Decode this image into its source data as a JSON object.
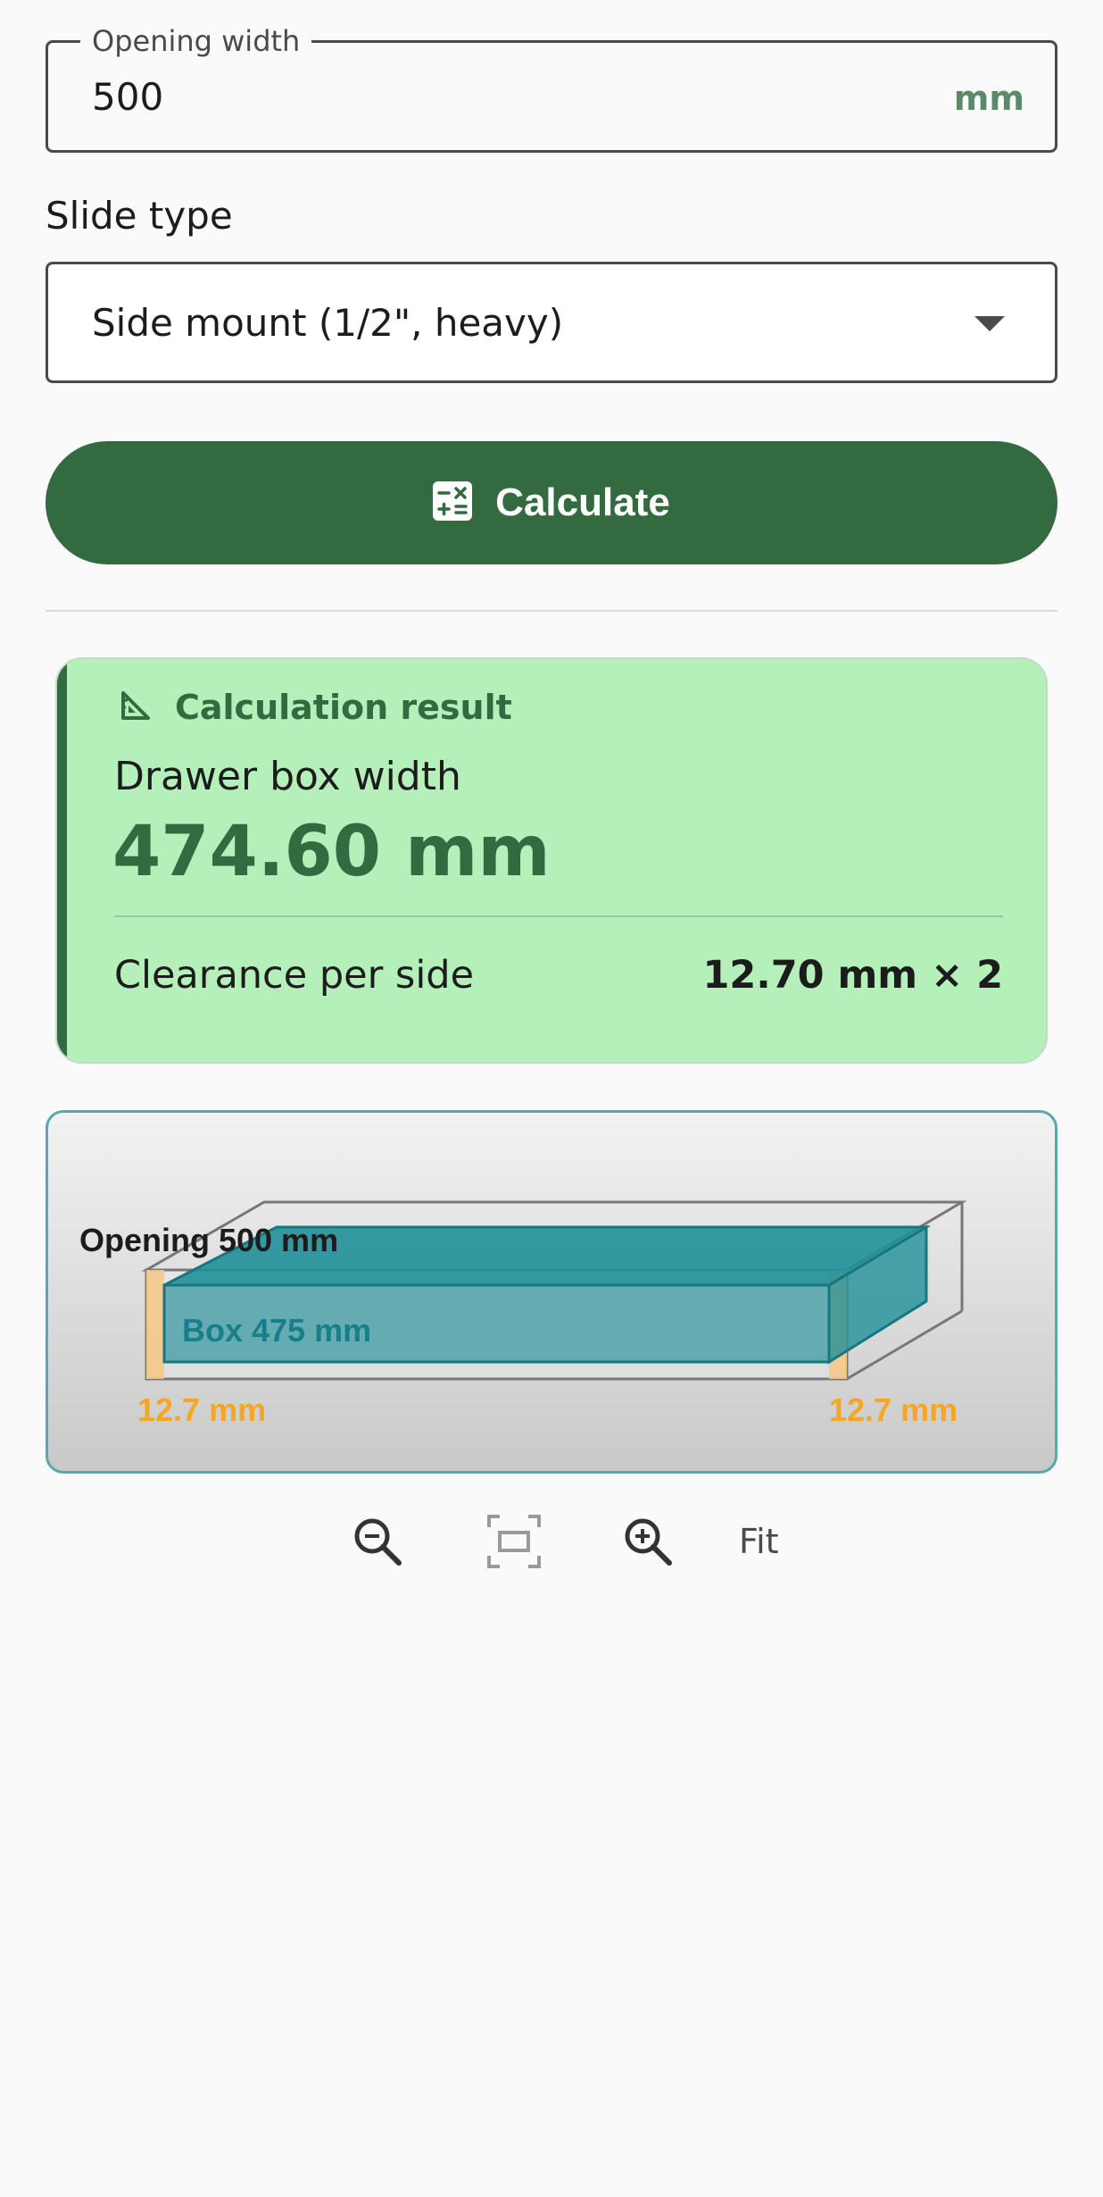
{
  "opening_field": {
    "label": "Opening width",
    "value": "500",
    "unit": "mm"
  },
  "slide_type": {
    "label": "Slide type",
    "selected": "Side mount (1/2\", heavy)"
  },
  "calculate_button": {
    "label": "Calculate",
    "icon": "calculator-icon"
  },
  "result": {
    "heading": "Calculation result",
    "heading_icon": "set-square-icon",
    "box_width_label": "Drawer box width",
    "box_width_value": "474.60 mm",
    "clearance_label": "Clearance per side",
    "clearance_value": "12.70 mm × 2"
  },
  "diagram": {
    "opening_label": "Opening 500 mm",
    "box_label": "Box 475 mm",
    "left_clearance_label": "12.7 mm",
    "right_clearance_label": "12.7 mm",
    "colors": {
      "box": "#208f98",
      "clearance": "#f5c98a",
      "clearance_text": "#f5a623"
    }
  },
  "zoom": {
    "fit_label": "Fit",
    "icons": [
      "zoom-out-icon",
      "fit-screen-icon",
      "zoom-in-icon"
    ]
  },
  "colors": {
    "primary": "#336a40",
    "result_bg": "#b5f0bb",
    "unit_accent": "#5a8a68"
  }
}
